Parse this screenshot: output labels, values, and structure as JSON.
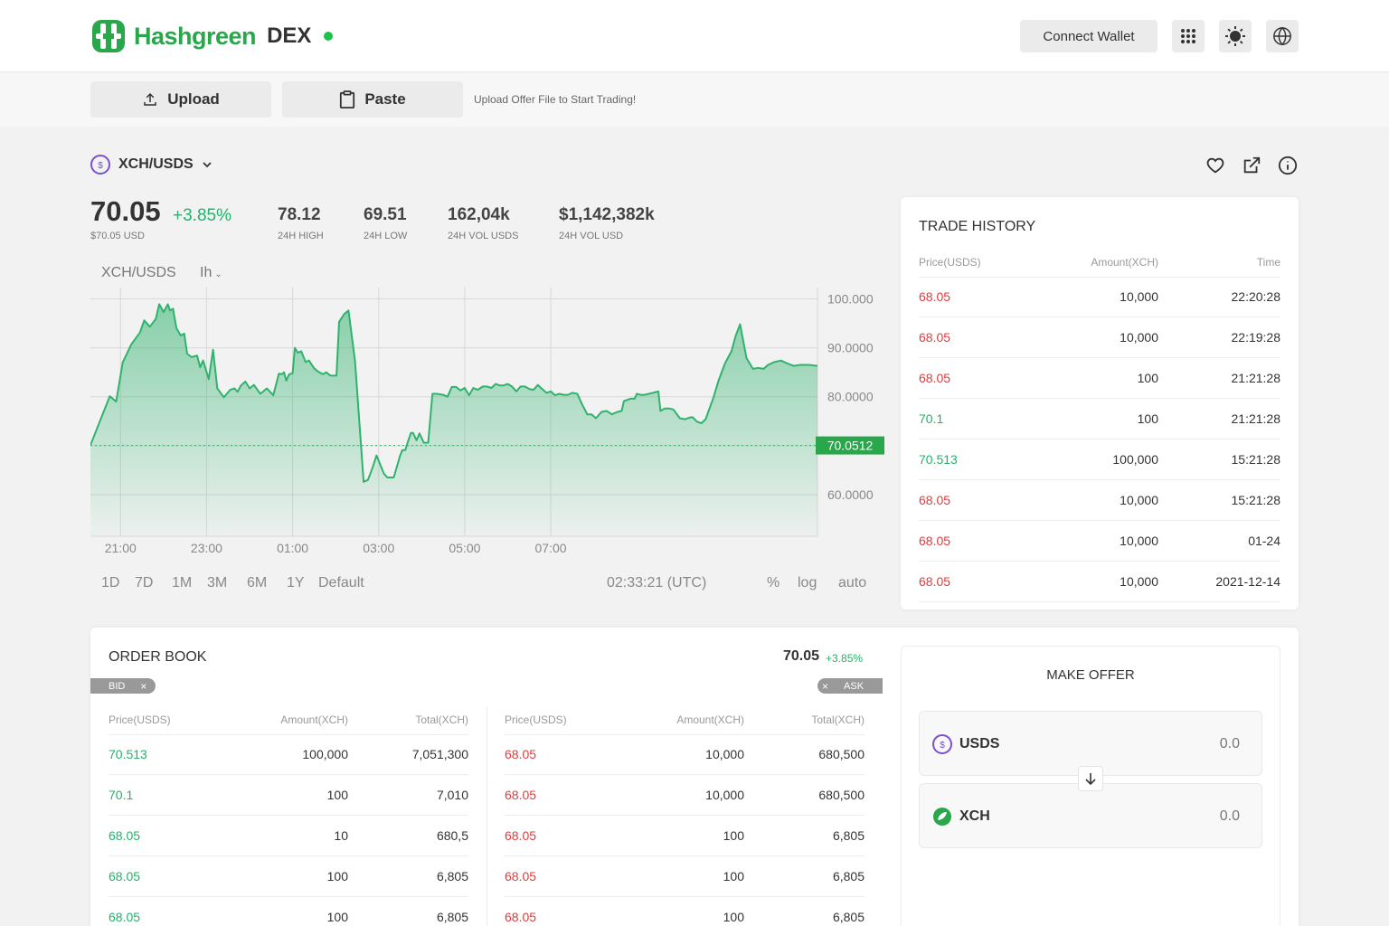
{
  "header": {
    "logo_text": "Hashgreen",
    "logo_suffix": "DEX",
    "status_color": "#1ec24a",
    "connect_wallet_label": "Connect Wallet",
    "icons": [
      "apps-grid-icon",
      "sun-theme-icon",
      "globe-language-icon"
    ]
  },
  "toolbar": {
    "upload_label": "Upload",
    "paste_label": "Paste",
    "hint": "Upload Offer File to Start Trading!"
  },
  "market": {
    "pair": "XCH/USDS",
    "price": "70.05",
    "change": "+3.85%",
    "price_usd": "$70.05 USD",
    "stats": [
      {
        "value": "78.12",
        "label": "24H HIGH"
      },
      {
        "value": "69.51",
        "label": "24H LOW"
      },
      {
        "value": "162,04k",
        "label": "24H VOL USDS"
      },
      {
        "value": "$1,142,382k",
        "label": "24H VOL USD"
      }
    ],
    "action_icons": [
      "heart-icon",
      "external-link-icon",
      "info-icon"
    ]
  },
  "chart": {
    "pair_label": "XCH/USDS",
    "interval": "Ih",
    "current_price_tag": "70.0512",
    "ranges": [
      "1D",
      "7D",
      "1M",
      "3M",
      "6M",
      "1Y",
      "Default"
    ],
    "clock": "02:33:21 (UTC)",
    "options": [
      "%",
      "log",
      "auto"
    ]
  },
  "chart_data": {
    "type": "area",
    "x_ticks": [
      "21:00",
      "23:00",
      "01:00",
      "03:00",
      "05:00",
      "07:00"
    ],
    "y_ticks": [
      "100.000",
      "90.0000",
      "80.0000",
      "70.0000",
      "60.0000"
    ],
    "ylim": [
      51.5,
      102.3
    ],
    "x_range": [
      20.3,
      32.9
    ],
    "last_value": 70.0512,
    "color": "#2fb36c",
    "series": [
      {
        "values": [
          [
            20.3,
            70.1
          ],
          [
            20.75,
            80.1
          ],
          [
            20.9,
            79.0
          ],
          [
            21.05,
            87.0
          ],
          [
            21.25,
            90.7
          ],
          [
            21.45,
            93.1
          ],
          [
            21.55,
            95.6
          ],
          [
            21.68,
            94.3
          ],
          [
            21.82,
            95.9
          ],
          [
            21.9,
            98.9
          ],
          [
            22.0,
            97.3
          ],
          [
            22.05,
            98.1
          ],
          [
            22.1,
            98.9
          ],
          [
            22.15,
            97.6
          ],
          [
            22.22,
            98.0
          ],
          [
            22.3,
            94.0
          ],
          [
            22.4,
            92.5
          ],
          [
            22.48,
            92.9
          ],
          [
            22.55,
            88.8
          ],
          [
            22.65,
            88.1
          ],
          [
            22.78,
            88.4
          ],
          [
            22.85,
            86.0
          ],
          [
            22.92,
            87.4
          ],
          [
            23.05,
            83.6
          ],
          [
            23.15,
            89.6
          ],
          [
            23.25,
            81.7
          ],
          [
            23.4,
            79.9
          ],
          [
            23.55,
            81.4
          ],
          [
            23.65,
            81.7
          ],
          [
            23.72,
            81.0
          ],
          [
            23.8,
            82.3
          ],
          [
            23.9,
            83.1
          ],
          [
            24.0,
            81.7
          ],
          [
            24.1,
            82.4
          ],
          [
            24.25,
            80.6
          ],
          [
            24.4,
            81.7
          ],
          [
            24.55,
            80.3
          ],
          [
            24.6,
            82.0
          ],
          [
            24.68,
            84.7
          ],
          [
            24.75,
            84.6
          ],
          [
            24.8,
            85.0
          ],
          [
            24.85,
            83.3
          ],
          [
            24.92,
            84.6
          ],
          [
            25.0,
            84.8
          ],
          [
            25.05,
            90.0
          ],
          [
            25.12,
            89.0
          ],
          [
            25.2,
            89.3
          ],
          [
            25.3,
            87.1
          ],
          [
            25.38,
            87.4
          ],
          [
            25.5,
            85.8
          ],
          [
            25.6,
            85.1
          ],
          [
            25.7,
            84.6
          ],
          [
            25.78,
            85.0
          ],
          [
            25.88,
            84.3
          ],
          [
            26.02,
            84.3
          ],
          [
            26.08,
            95.3
          ],
          [
            26.2,
            96.9
          ],
          [
            26.3,
            97.6
          ],
          [
            26.45,
            87.3
          ],
          [
            26.65,
            62.6
          ],
          [
            26.75,
            63.0
          ],
          [
            26.85,
            65.3
          ],
          [
            26.95,
            68.0
          ],
          [
            27.12,
            64.3
          ],
          [
            27.2,
            63.5
          ],
          [
            27.35,
            63.5
          ],
          [
            27.5,
            68.0
          ],
          [
            27.55,
            69.1
          ],
          [
            27.62,
            69.1
          ],
          [
            27.68,
            70.8
          ],
          [
            27.75,
            72.6
          ],
          [
            27.8,
            72.6
          ],
          [
            27.88,
            71.1
          ],
          [
            27.95,
            72.5
          ],
          [
            28.05,
            70.6
          ],
          [
            28.15,
            70.6
          ],
          [
            28.25,
            80.6
          ],
          [
            28.35,
            80.6
          ],
          [
            28.5,
            80.4
          ],
          [
            28.6,
            80.0
          ],
          [
            28.7,
            82.0
          ],
          [
            28.8,
            82.0
          ],
          [
            28.9,
            81.3
          ],
          [
            29.0,
            81.8
          ],
          [
            29.1,
            80.3
          ],
          [
            29.2,
            81.8
          ],
          [
            29.3,
            81.4
          ],
          [
            29.42,
            82.1
          ],
          [
            29.52,
            82.1
          ],
          [
            29.62,
            81.8
          ],
          [
            29.72,
            82.6
          ],
          [
            29.82,
            82.3
          ],
          [
            29.9,
            82.3
          ],
          [
            30.0,
            82.6
          ],
          [
            30.1,
            82.1
          ],
          [
            30.2,
            81.1
          ],
          [
            30.3,
            82.1
          ],
          [
            30.4,
            82.1
          ],
          [
            30.5,
            81.6
          ],
          [
            30.6,
            81.4
          ],
          [
            30.7,
            82.4
          ],
          [
            30.8,
            81.6
          ],
          [
            30.9,
            80.8
          ],
          [
            31.0,
            81.1
          ],
          [
            31.1,
            80.3
          ],
          [
            31.2,
            80.6
          ],
          [
            31.3,
            80.4
          ],
          [
            31.4,
            80.4
          ],
          [
            31.5,
            80.8
          ],
          [
            31.62,
            80.6
          ],
          [
            31.72,
            78.6
          ],
          [
            31.85,
            76.4
          ],
          [
            31.95,
            76.4
          ],
          [
            32.05,
            75.6
          ],
          [
            32.18,
            76.9
          ],
          [
            32.3,
            77.1
          ],
          [
            32.42,
            76.4
          ],
          [
            32.55,
            76.9
          ],
          [
            32.65,
            77.1
          ],
          [
            32.7,
            79.1
          ],
          [
            32.85,
            79.6
          ],
          [
            32.95,
            79.6
          ],
          [
            33.0,
            80.6
          ],
          [
            33.08,
            80.4
          ],
          [
            33.18,
            80.4
          ],
          [
            33.28,
            80.6
          ],
          [
            33.38,
            80.8
          ],
          [
            33.5,
            81.1
          ],
          [
            33.55,
            77.1
          ],
          [
            33.65,
            77.6
          ],
          [
            33.75,
            77.6
          ],
          [
            33.85,
            77.4
          ],
          [
            34.0,
            75.6
          ],
          [
            34.12,
            75.4
          ],
          [
            34.25,
            75.8
          ],
          [
            34.3,
            75.8
          ],
          [
            34.4,
            74.9
          ],
          [
            34.5,
            74.6
          ],
          [
            34.6,
            75.4
          ],
          [
            34.78,
            79.8
          ],
          [
            34.9,
            83.3
          ],
          [
            35.05,
            86.8
          ],
          [
            35.2,
            89.3
          ],
          [
            35.3,
            92.5
          ],
          [
            35.4,
            94.8
          ],
          [
            35.55,
            87.9
          ],
          [
            35.7,
            85.7
          ],
          [
            35.82,
            85.9
          ],
          [
            35.95,
            85.7
          ],
          [
            36.05,
            86.5
          ],
          [
            36.2,
            87.1
          ],
          [
            36.35,
            87.4
          ],
          [
            36.5,
            86.8
          ],
          [
            36.65,
            86.3
          ],
          [
            36.8,
            86.5
          ],
          [
            37.0,
            86.5
          ],
          [
            37.2,
            86.3
          ]
        ]
      }
    ]
  },
  "trade_history": {
    "title": "TRADE HISTORY",
    "columns": [
      "Price(USDS)",
      "Amount(XCH)",
      "Time"
    ],
    "rows": [
      {
        "price": "68.05",
        "side": "sell",
        "amount": "10,000",
        "time": "22:20:28"
      },
      {
        "price": "68.05",
        "side": "sell",
        "amount": "10,000",
        "time": "22:19:28"
      },
      {
        "price": "68.05",
        "side": "sell",
        "amount": "100",
        "time": "21:21:28"
      },
      {
        "price": "70.1",
        "side": "buy",
        "amount": "100",
        "time": "21:21:28"
      },
      {
        "price": "70.513",
        "side": "buy",
        "amount": "100,000",
        "time": "15:21:28"
      },
      {
        "price": "68.05",
        "side": "sell",
        "amount": "10,000",
        "time": "15:21:28"
      },
      {
        "price": "68.05",
        "side": "sell",
        "amount": "10,000",
        "time": "01-24"
      },
      {
        "price": "68.05",
        "side": "sell",
        "amount": "10,000",
        "time": "2021-12-14"
      }
    ]
  },
  "order_book": {
    "title": "ORDER BOOK",
    "price": "70.05",
    "change": "+3.85%",
    "bid_chip": "BID",
    "ask_chip": "ASK",
    "columns": [
      "Price(USDS)",
      "Amount(XCH)",
      "Total(XCH)"
    ],
    "bids": [
      {
        "price": "70.513",
        "amount": "100,000",
        "total": "7,051,300"
      },
      {
        "price": "70.1",
        "amount": "100",
        "total": "7,010"
      },
      {
        "price": "68.05",
        "amount": "10",
        "total": "680,5"
      },
      {
        "price": "68.05",
        "amount": "100",
        "total": "6,805"
      },
      {
        "price": "68.05",
        "amount": "100",
        "total": "6,805"
      }
    ],
    "asks": [
      {
        "price": "68.05",
        "amount": "10,000",
        "total": "680,500"
      },
      {
        "price": "68.05",
        "amount": "10,000",
        "total": "680,500"
      },
      {
        "price": "68.05",
        "amount": "100",
        "total": "6,805"
      },
      {
        "price": "68.05",
        "amount": "100",
        "total": "6,805"
      },
      {
        "price": "68.05",
        "amount": "100",
        "total": "6,805"
      }
    ]
  },
  "make_offer": {
    "title": "MAKE OFFER",
    "from": {
      "token": "USDS",
      "amount": "0.0",
      "icon": "usds-coin-icon"
    },
    "to": {
      "token": "XCH",
      "amount": "0.0",
      "icon": "xch-coin-icon"
    }
  },
  "colors": {
    "buy": "#22b36a",
    "sell": "#e03c3c",
    "brand": "#2aa64b"
  }
}
